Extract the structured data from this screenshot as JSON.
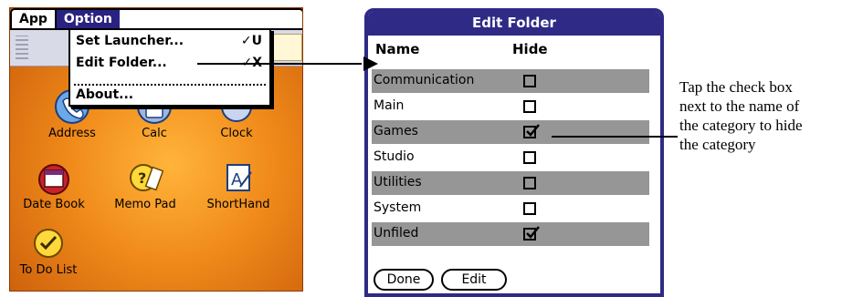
{
  "launcher": {
    "menubar": {
      "app": "App",
      "option": "Option"
    },
    "dropdown": {
      "items": [
        {
          "label": "Set Launcher...",
          "shortcut": "✓U"
        },
        {
          "label": "Edit Folder...",
          "shortcut": "✓X"
        },
        {
          "label": "About..."
        }
      ]
    },
    "apps": [
      {
        "label": "Address",
        "icon": "address-icon"
      },
      {
        "label": "Calc",
        "icon": "calc-icon"
      },
      {
        "label": "Clock",
        "icon": "clock-icon"
      },
      {
        "label": "Date Book",
        "icon": "datebook-icon"
      },
      {
        "label": "Memo Pad",
        "icon": "memopad-icon"
      },
      {
        "label": "ShortHand",
        "icon": "shorthand-icon"
      },
      {
        "label": "To Do List",
        "icon": "todo-icon"
      }
    ],
    "colors": {
      "menu_highlight": "#2a2280",
      "wallpaper": "#f08a1a"
    }
  },
  "dialog": {
    "title": "Edit Folder",
    "columns": {
      "name": "Name",
      "hide": "Hide"
    },
    "rows": [
      {
        "name": "Communication",
        "hidden": false
      },
      {
        "name": "Main",
        "hidden": false
      },
      {
        "name": "Games",
        "hidden": true
      },
      {
        "name": "Studio",
        "hidden": false
      },
      {
        "name": "Utilities",
        "hidden": false
      },
      {
        "name": "System",
        "hidden": false
      },
      {
        "name": "Unfiled",
        "hidden": true
      }
    ],
    "buttons": {
      "done": "Done",
      "edit": "Edit"
    },
    "colors": {
      "title_bar": "#2e2a86",
      "shaded_row": "#969696"
    }
  },
  "annotation": {
    "lines": [
      "Tap the check box",
      "next to the name of",
      "the category to hide",
      "the category"
    ]
  }
}
